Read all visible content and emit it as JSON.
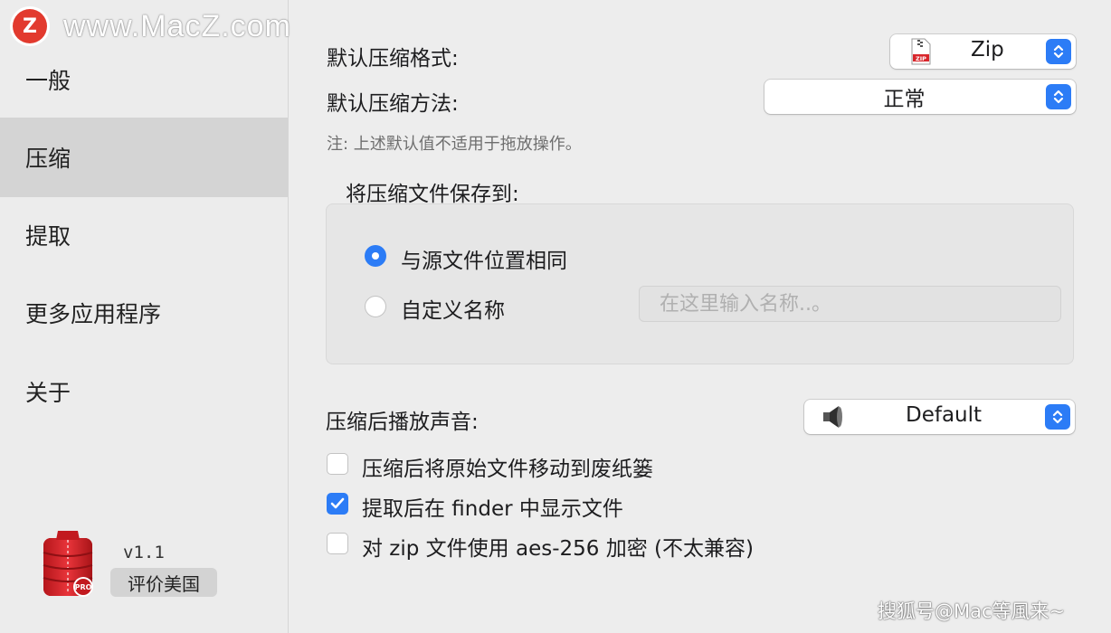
{
  "watermark": {
    "logo_letter": "Z",
    "text": "www.MacZ.com"
  },
  "sidebar": {
    "items": [
      {
        "label": "一般",
        "active": false
      },
      {
        "label": "压缩",
        "active": true
      },
      {
        "label": "提取",
        "active": false
      },
      {
        "label": "更多应用程序",
        "active": false
      },
      {
        "label": "关于",
        "active": false
      }
    ],
    "version": "v1.1",
    "rate_button": "评价美国",
    "app_icon": "archiver-pro-icon",
    "app_icon_badge": "PRO"
  },
  "compress": {
    "default_format_label": "默认压缩格式:",
    "default_format_value": "Zip",
    "default_format_icon": "zip-file-icon",
    "zip_icon_text": "ZIP",
    "default_method_label": "默认压缩方法:",
    "default_method_value": "正常",
    "note": "注: 上述默认值不适用于拖放操作。",
    "save_to_label": "将压缩文件保存到:",
    "options": [
      {
        "label": "与源文件位置相同",
        "selected": true
      },
      {
        "label": "自定义名称",
        "selected": false
      }
    ],
    "custom_name_placeholder": "在这里输入名称..。",
    "sound_label": "压缩后播放声音:",
    "sound_value": "Default",
    "sound_icon": "speaker-icon",
    "checkboxes": [
      {
        "label": "压缩后将原始文件移动到废纸篓",
        "checked": false
      },
      {
        "label": "提取后在 finder 中显示文件",
        "checked": true
      },
      {
        "label": "对 zip 文件使用 aes-256 加密 (不太兼容)",
        "checked": false
      }
    ]
  },
  "credit": "搜狐号@Mac等風来~",
  "colors": {
    "accent": "#2c7cf6",
    "sidebar_active": "#d4d4d4",
    "background": "#ededed"
  }
}
